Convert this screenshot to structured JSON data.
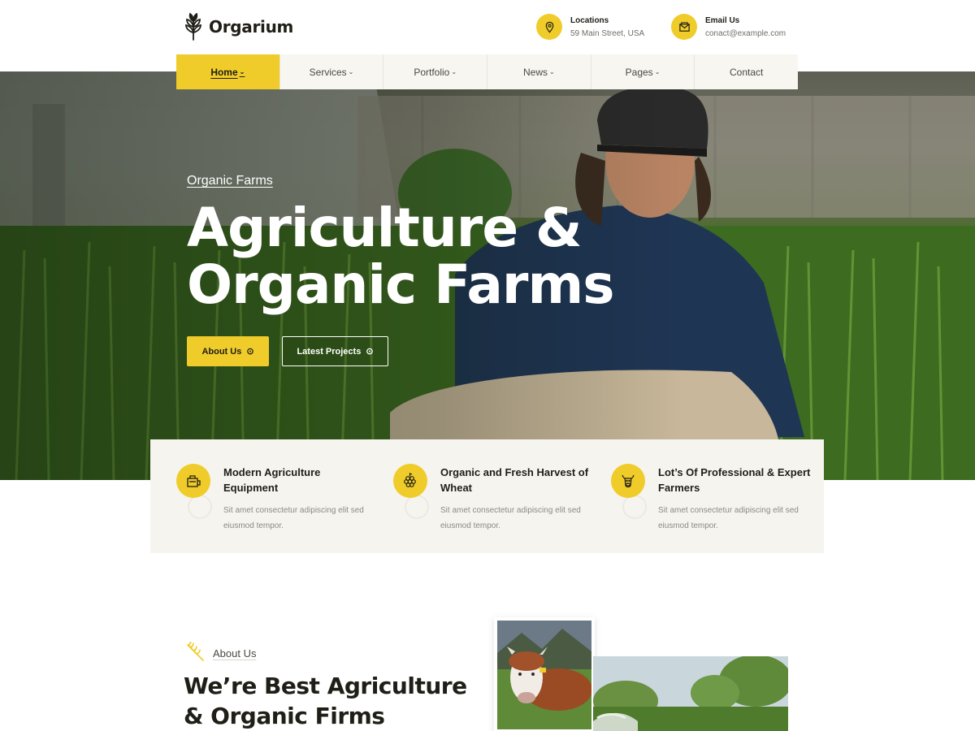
{
  "brand": {
    "name": "Orgarium",
    "logo_icon": "wheat-icon"
  },
  "contacts": [
    {
      "title": "Locations",
      "value": "59 Main Street, USA",
      "icon": "location-pin-icon"
    },
    {
      "title": "Email Us",
      "value": "conact@example.com",
      "icon": "envelope-icon"
    }
  ],
  "nav": {
    "items": [
      {
        "label": "Home",
        "has_dropdown": true,
        "active": true
      },
      {
        "label": "Services",
        "has_dropdown": true
      },
      {
        "label": "Portfolio",
        "has_dropdown": true
      },
      {
        "label": "News",
        "has_dropdown": true
      },
      {
        "label": "Pages",
        "has_dropdown": true
      },
      {
        "label": "Contact",
        "has_dropdown": false
      }
    ],
    "chevron": "⌄"
  },
  "hero": {
    "tagline": "Organic Farms",
    "title": "Agriculture & Organic Farms",
    "buttons": {
      "primary": "About Us",
      "secondary": "Latest Projects",
      "arrow": "⊙"
    }
  },
  "features": [
    {
      "title": "Modern Agriculture Equipment",
      "text": "Sit amet consectetur adipiscing elit sed eiusmod tempor.",
      "icon": "equipment-icon"
    },
    {
      "title": "Organic and Fresh Harvest of Wheat",
      "text": "Sit amet consectetur adipiscing elit sed eiusmod tempor.",
      "icon": "grapes-icon"
    },
    {
      "title": "Lot’s Of Professional & Expert Farmers",
      "text": "Sit amet consectetur adipiscing elit sed eiusmod tempor.",
      "icon": "cow-icon"
    }
  ],
  "about": {
    "tag": "About Us",
    "title": "We’re Best Agriculture & Organic Firms"
  },
  "colors": {
    "accent": "#f0cc2a",
    "dark": "#1f1e17",
    "muted": "#8b8a82",
    "panel": "#f5f4ee"
  }
}
